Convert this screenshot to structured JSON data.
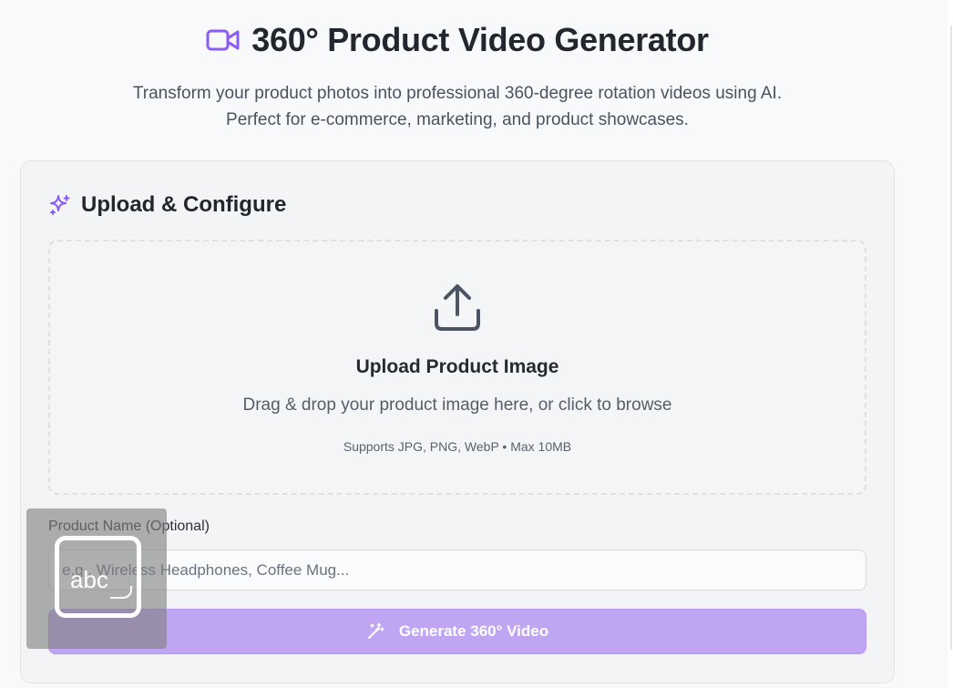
{
  "header": {
    "icon": "video-camera-icon",
    "title": "360° Product Video Generator",
    "subtitle_line1": "Transform your product photos into professional 360-degree rotation videos using AI.",
    "subtitle_line2": "Perfect for e-commerce, marketing, and product showcases."
  },
  "card": {
    "icon": "sparkles-icon",
    "title": "Upload & Configure",
    "dropzone": {
      "icon": "upload-icon",
      "title": "Upload Product Image",
      "description": "Drag & drop your product image here, or click to browse",
      "note": "Supports JPG, PNG, WebP • Max 10MB"
    },
    "product_name": {
      "label": "Product Name (Optional)",
      "value": "",
      "placeholder": "e.g., Wireless Headphones, Coffee Mug..."
    },
    "generate_button": {
      "icon": "magic-wand-icon",
      "label": "Generate 360° Video",
      "state": "disabled"
    }
  },
  "overlay": {
    "icon": "text-input-abc-icon",
    "text": "abc"
  },
  "colors": {
    "accent": "#8b5cf6",
    "button_disabled": "#c0a5f3",
    "background": "#f8f9fa"
  }
}
